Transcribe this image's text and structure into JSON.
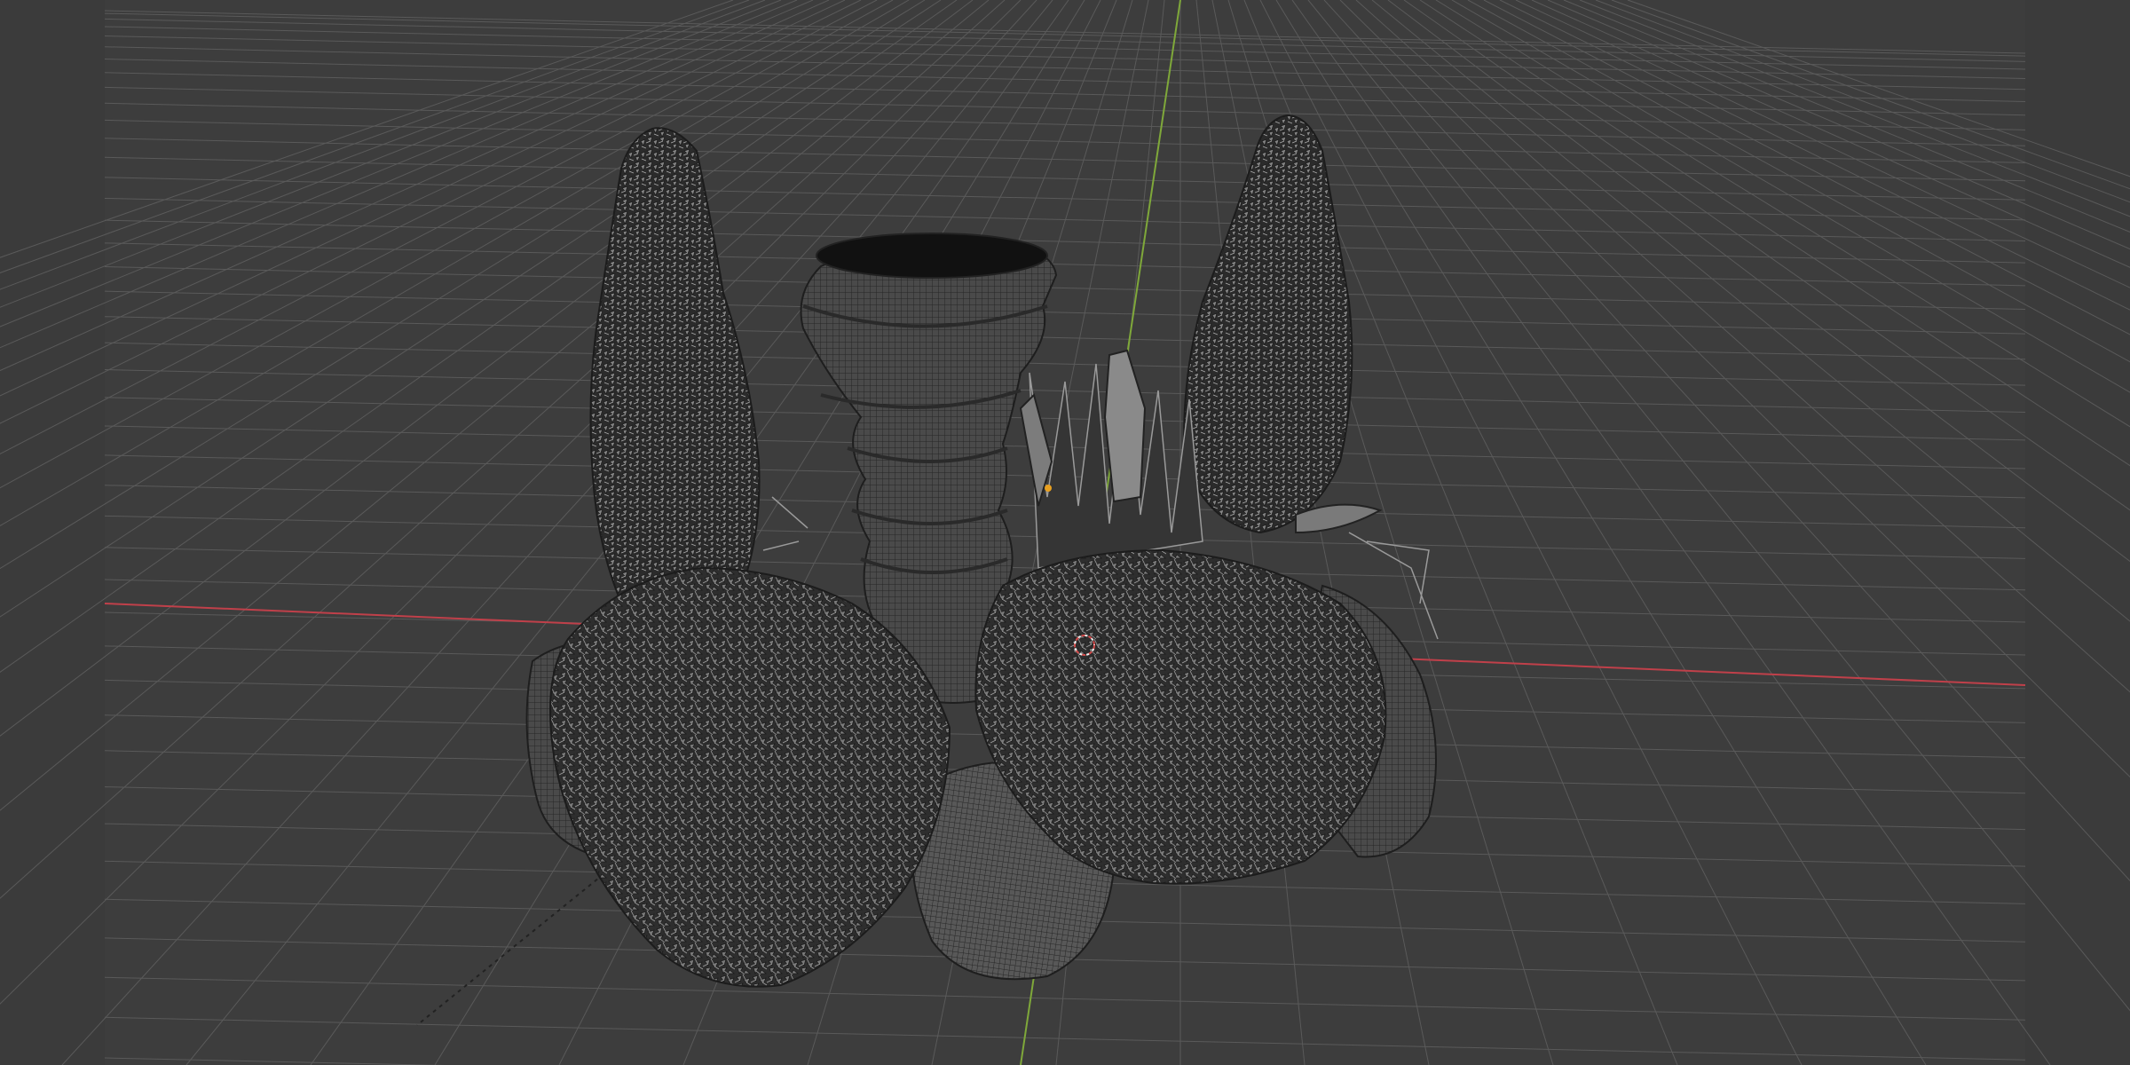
{
  "app": {
    "name": "3D Viewport",
    "view": "wireframe",
    "background_color": "#3d3d3d"
  },
  "scene": {
    "axis_x_color": "#c0404a",
    "axis_y_color": "#7fa83a",
    "grid_color": "#5a5a5a",
    "mesh_color": "#9a9a9a",
    "objects": [
      {
        "name": "stone-pillar",
        "icon": "pillar"
      },
      {
        "name": "cypress-tree-left",
        "icon": "tree"
      },
      {
        "name": "cypress-tree-right",
        "icon": "tree"
      },
      {
        "name": "grass-clump",
        "icon": "grass"
      },
      {
        "name": "shrub-left",
        "icon": "shrub"
      },
      {
        "name": "shrub-right",
        "icon": "shrub"
      },
      {
        "name": "rock-left",
        "icon": "rock"
      },
      {
        "name": "rock-front",
        "icon": "rock"
      },
      {
        "name": "rock-right",
        "icon": "rock"
      }
    ],
    "cursor_3d": {
      "color": "#d24a4a"
    },
    "origin_point": {
      "color": "#e8a020"
    }
  }
}
